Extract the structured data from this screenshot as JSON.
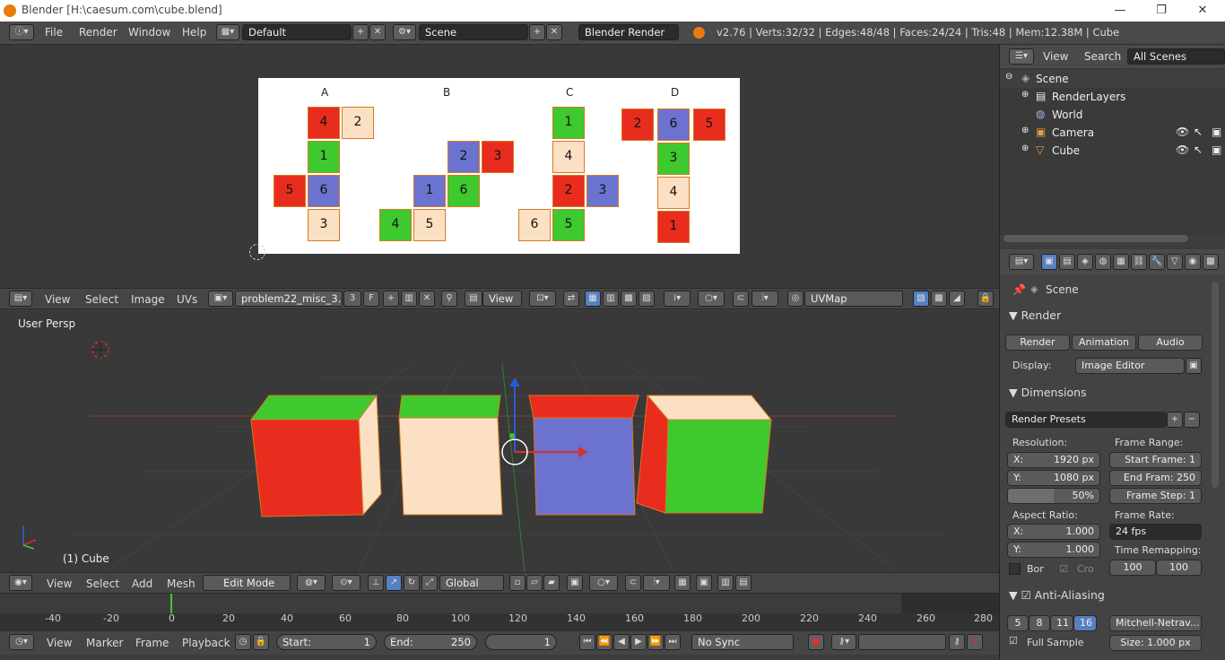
{
  "window": {
    "title": "Blender [H:\\caesum.com\\cube.blend]",
    "min": "—",
    "max": "❐",
    "close": "✕"
  },
  "menu": {
    "file": "File",
    "render": "Render",
    "window": "Window",
    "help": "Help",
    "layout": "Default",
    "scene": "Scene",
    "engine": "Blender Render",
    "stats": "v2.76 | Verts:32/32 | Edges:48/48 | Faces:24/24 | Tris:48 | Mem:12.38M | Cube"
  },
  "uv_image": {
    "columns": [
      "A",
      "B",
      "C",
      "D"
    ],
    "A": [
      "4",
      "2",
      "1",
      "5",
      "6",
      "3"
    ],
    "B": [
      "2",
      "3",
      "1",
      "6",
      "4",
      "5"
    ],
    "C": [
      "1",
      "4",
      "2",
      "3",
      "6",
      "5"
    ],
    "D": [
      "2",
      "6",
      "5",
      "3",
      "4",
      "1"
    ]
  },
  "image_header": {
    "view": "View",
    "select": "Select",
    "image": "Image",
    "uvs": "UVs",
    "image_name": "problem22_misc_3....",
    "users": "3",
    "fake": "F",
    "view2": "View",
    "uvmap": "UVMap"
  },
  "viewport": {
    "persp": "User Persp",
    "object": "(1) Cube"
  },
  "viewport_header": {
    "view": "View",
    "select": "Select",
    "add": "Add",
    "mesh": "Mesh",
    "mode": "Edit Mode",
    "orientation": "Global"
  },
  "timeline": {
    "ticks": [
      "-40",
      "-20",
      "0",
      "20",
      "40",
      "60",
      "80",
      "100",
      "120",
      "140",
      "160",
      "180",
      "200",
      "220",
      "240",
      "260",
      "280"
    ]
  },
  "playback": {
    "view": "View",
    "marker": "Marker",
    "frame": "Frame",
    "playback": "Playback",
    "start_label": "Start:",
    "start": "1",
    "end_label": "End:",
    "end": "250",
    "current": "1",
    "sync": "No Sync"
  },
  "outliner": {
    "view": "View",
    "search": "Search",
    "scope": "All Scenes",
    "items": [
      "Scene",
      "RenderLayers",
      "World",
      "Camera",
      "Cube"
    ]
  },
  "properties": {
    "scene": "Scene",
    "render_section": "Render",
    "render_btn": "Render",
    "animation_btn": "Animation",
    "audio_btn": "Audio",
    "display_label": "Display:",
    "display_value": "Image Editor",
    "dimensions": "Dimensions",
    "presets": "Render Presets",
    "resolution": "Resolution:",
    "res_x": "X:",
    "res_x_val": "1920 px",
    "res_y": "Y:",
    "res_y_val": "1080 px",
    "res_pct": "50%",
    "frame_range": "Frame Range:",
    "start_frame": "Start Frame: 1",
    "end_frame": "End Fram: 250",
    "frame_step": "Frame Step: 1",
    "aspect": "Aspect Ratio:",
    "asp_x": "X:",
    "asp_x_val": "1.000",
    "asp_y": "Y:",
    "asp_y_val": "1.000",
    "frame_rate": "Frame Rate:",
    "fps": "24 fps",
    "time_remap": "Time Remapping:",
    "remap_old": "100",
    "remap_new": "100",
    "border": "Bor",
    "crop": "Cro",
    "antialiasing": "Anti-Aliasing",
    "aa_values": [
      "5",
      "8",
      "11",
      "16"
    ],
    "aa_filter": "Mitchell-Netrav...",
    "full_sample": "Full Sample",
    "size": "Size: 1.000 px"
  },
  "colors": {
    "red": "#e82c1e",
    "green": "#3ec92f",
    "blue": "#6b73cf",
    "tan": "#fbe0c4",
    "selected": "#d67a20",
    "accent": "#5680c2"
  }
}
